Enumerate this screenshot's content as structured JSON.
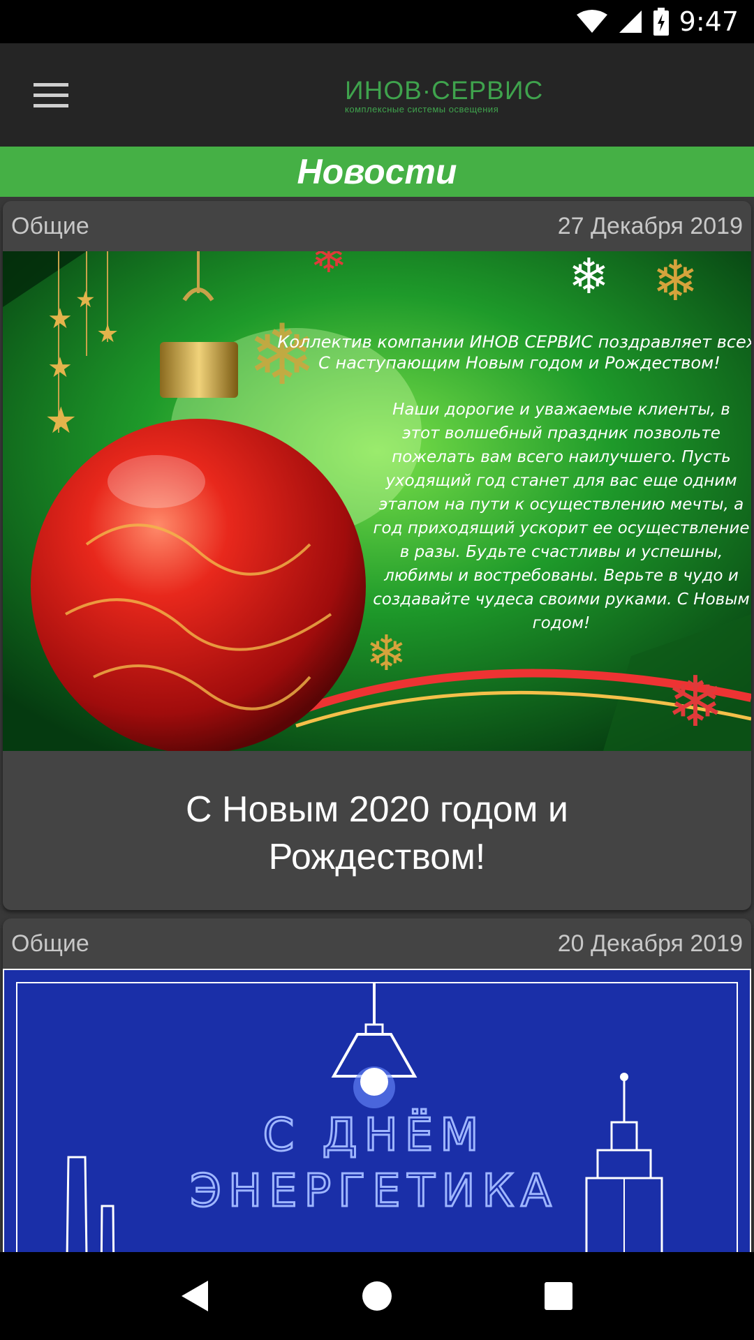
{
  "status_bar": {
    "time": "9:47",
    "icons": [
      "wifi-icon",
      "cell-signal-icon",
      "battery-charging-icon"
    ]
  },
  "app_bar": {
    "menu_icon": "hamburger-menu-icon",
    "logo": {
      "name": "ИНОВ·СЕРВИС",
      "tagline": "комплексные системы освещения"
    }
  },
  "page": {
    "title": "Новости"
  },
  "news": [
    {
      "category": "Общие",
      "date": "27 Декабря 2019",
      "title": "С Новым 2020 годом и Рождеством!",
      "image": {
        "text_line1": "Коллектив компании ИНОВ СЕРВИС поздравляет всех",
        "text_line2": "С наступающим Новым годом и Рождеством!",
        "body": "Наши дорогие и уважаемые клиенты, в этот волшебный праздник позвольте пожелать вам всего наилучшего. Пусть уходящий год станет для вас еще одним этапом на пути к осуществлению мечты, а год приходящий ускорит ее осуществление в разы. Будьте счастливы и успешны, любимы и востребованы. Верьте в чудо и создавайте чудеса своими руками. С Новым годом!"
      }
    },
    {
      "category": "Общие",
      "date": "20 Декабря 2019",
      "image": {
        "line1": "С ДНЁМ",
        "line2": "ЭНЕРГЕТИКА"
      }
    }
  ],
  "nav_bar": {
    "icons": [
      "back-icon",
      "home-icon",
      "recents-icon"
    ]
  },
  "colors": {
    "accent_green": "#45b045",
    "logo_green": "#3fa34d",
    "card_bg": "#444444",
    "background": "#383838",
    "blueprint_blue": "#1a2fa8"
  }
}
